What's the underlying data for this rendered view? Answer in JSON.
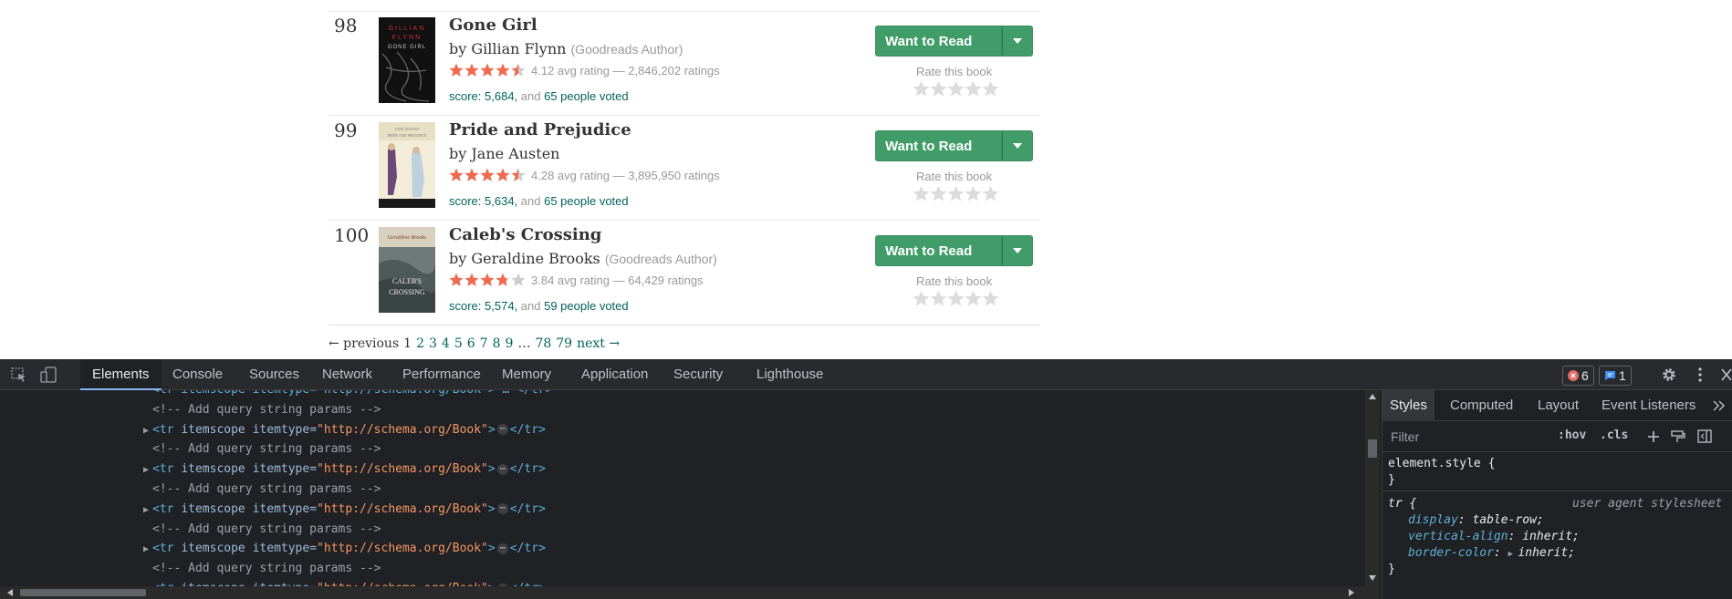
{
  "books": [
    {
      "rank": "98",
      "title": "Gone Girl",
      "by": "by",
      "author": "Gillian Flynn",
      "author_badge": "(Goodreads Author)",
      "avg_rating": 4.12,
      "rating_text": "4.12 avg rating — 2,846,202 ratings",
      "score": "score: 5,684,",
      "and": "and",
      "voted": "65 people voted",
      "want_to_read": "Want to Read",
      "rate_label": "Rate this book",
      "cover": "gone-girl-cover"
    },
    {
      "rank": "99",
      "title": "Pride and Prejudice",
      "by": "by",
      "author": "Jane Austen",
      "author_badge": "",
      "avg_rating": 4.28,
      "rating_text": "4.28 avg rating — 3,895,950 ratings",
      "score": "score: 5,634,",
      "and": "and",
      "voted": "65 people voted",
      "want_to_read": "Want to Read",
      "rate_label": "Rate this book",
      "cover": "pride-and-prejudice-cover"
    },
    {
      "rank": "100",
      "title": "Caleb's Crossing",
      "by": "by",
      "author": "Geraldine Brooks",
      "author_badge": "(Goodreads Author)",
      "avg_rating": 3.84,
      "rating_text": "3.84 avg rating — 64,429 ratings",
      "score": "score: 5,574,",
      "and": "and",
      "voted": "59 people voted",
      "want_to_read": "Want to Read",
      "rate_label": "Rate this book",
      "cover": "calebs-crossing-cover"
    }
  ],
  "pagination": {
    "previous": "← previous",
    "pages": [
      "1",
      "2",
      "3",
      "4",
      "5",
      "6",
      "7",
      "8",
      "9"
    ],
    "current": "1",
    "ellipsis": "…",
    "last_pages": [
      "78",
      "79"
    ],
    "next": "next →"
  },
  "devtools": {
    "tabs": [
      "Elements",
      "Console",
      "Sources",
      "Network",
      "Performance",
      "Memory",
      "Application",
      "Security",
      "Lighthouse"
    ],
    "active_tab": "Elements",
    "error_count": "6",
    "message_count": "1",
    "dom_lines": [
      {
        "type": "partial",
        "text": "<tr itemscope itemtype=\"http://schema.org/Book\"> … </tr>"
      },
      {
        "type": "comment",
        "text": "<!-- Add query string params -->"
      },
      {
        "type": "tr",
        "tag": "tr",
        "attr1": "itemscope",
        "attr2": "itemtype",
        "value": "\"http://schema.org/Book\""
      },
      {
        "type": "comment",
        "text": "<!-- Add query string params -->"
      },
      {
        "type": "tr",
        "tag": "tr",
        "attr1": "itemscope",
        "attr2": "itemtype",
        "value": "\"http://schema.org/Book\""
      },
      {
        "type": "comment",
        "text": "<!-- Add query string params -->"
      },
      {
        "type": "tr",
        "tag": "tr",
        "attr1": "itemscope",
        "attr2": "itemtype",
        "value": "\"http://schema.org/Book\""
      },
      {
        "type": "comment",
        "text": "<!-- Add query string params -->"
      },
      {
        "type": "tr",
        "tag": "tr",
        "attr1": "itemscope",
        "attr2": "itemtype",
        "value": "\"http://schema.org/Book\""
      },
      {
        "type": "comment",
        "text": "<!-- Add query string params -->"
      },
      {
        "type": "tr",
        "tag": "tr",
        "attr1": "itemscope",
        "attr2": "itemtype",
        "value": "\"http://schema.org/Book\""
      }
    ],
    "styles_tabs": [
      "Styles",
      "Computed",
      "Layout",
      "Event Listeners"
    ],
    "styles_active": "Styles",
    "filter_placeholder": "Filter",
    "hov": ":hov",
    "cls": ".cls",
    "element_style": "element.style {",
    "close_brace": "}",
    "rule_selector": "tr {",
    "rule_source": "user agent stylesheet",
    "declarations": [
      {
        "prop": "display",
        "value": "table-row;"
      },
      {
        "prop": "vertical-align",
        "value": "inherit;"
      },
      {
        "prop": "border-color",
        "value": "inherit;"
      }
    ]
  },
  "colors": {
    "star_filled": "#e87400",
    "star_empty": "#cccccc",
    "rate_star": "#dcdcdc",
    "wtr_green": "#409d69",
    "link_teal": "#00635d",
    "rating_star_red": "#f06a4e"
  }
}
